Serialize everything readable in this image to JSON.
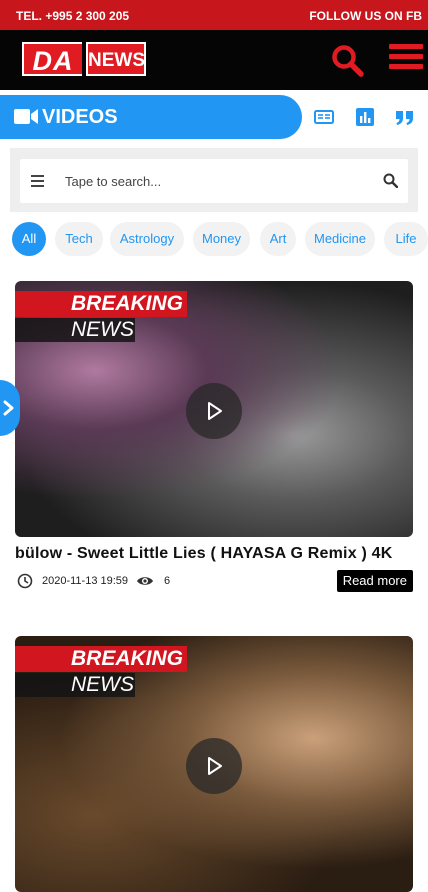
{
  "topbar": {
    "phone": "TEL. +995 2 300 205",
    "follow": "FOLLOW US ON FB"
  },
  "header": {
    "logo_left": "DA",
    "logo_right": "NEWS",
    "search_icon": "search-icon",
    "menu_icon": "hamburger-menu-icon"
  },
  "section": {
    "title": "VIDEOS",
    "title_icon": "video-camera-icon",
    "view_icons": [
      "list-view-icon",
      "chart-view-icon",
      "quote-view-icon"
    ]
  },
  "search": {
    "placeholder": "Tape to search..."
  },
  "categories": [
    "All",
    "Tech",
    "Astrology",
    "Money",
    "Art",
    "Medicine",
    "Life"
  ],
  "active_category": "All",
  "badge": {
    "line1": "BREAKING",
    "line2": "NEWS"
  },
  "videos": [
    {
      "title": "bülow - Sweet Little Lies ( HAYASA G Remix ) 4K",
      "date": "2020-11-13 19:59",
      "views": "6",
      "read_more": "Read more"
    },
    {
      "title": "",
      "date": "",
      "views": "",
      "read_more": ""
    }
  ],
  "colors": {
    "brand_red": "#c8161d",
    "accent_blue": "#2196f3",
    "header_black": "#050505"
  }
}
